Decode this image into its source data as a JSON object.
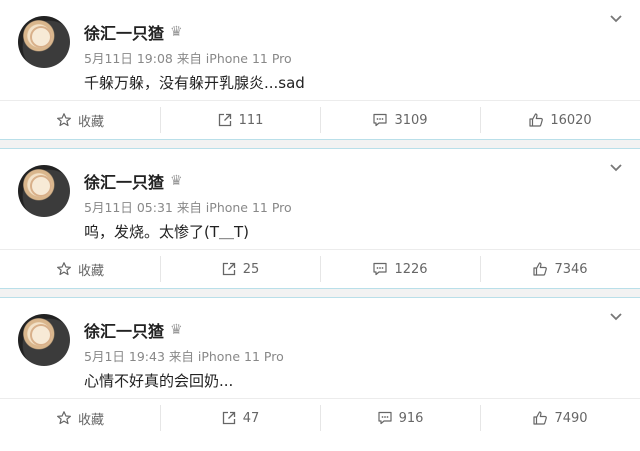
{
  "posts": [
    {
      "username": "徐汇一只猹",
      "meta": "5月11日 19:08 来自 iPhone 11 Pro",
      "content": "千躲万躲，没有躲开乳腺炎...sad",
      "actions": {
        "favorite_label": "收藏",
        "repost_count": "111",
        "comment_count": "3109",
        "like_count": "16020"
      }
    },
    {
      "username": "徐汇一只猹",
      "meta": "5月11日 05:31 来自 iPhone 11 Pro",
      "content": "呜，发烧。太惨了(T＿T)",
      "actions": {
        "favorite_label": "收藏",
        "repost_count": "25",
        "comment_count": "1226",
        "like_count": "7346"
      }
    },
    {
      "username": "徐汇一只猹",
      "meta": "5月1日 19:43 来自 iPhone 11 Pro",
      "content": "心情不好真的会回奶...",
      "actions": {
        "favorite_label": "收藏",
        "repost_count": "47",
        "comment_count": "916",
        "like_count": "7490"
      }
    }
  ],
  "icons": {
    "badge": "crown-badge-icon",
    "menu": "chevron-down-icon",
    "favorite": "star-icon",
    "repost": "share-icon",
    "comment": "comment-icon",
    "like": "thumbs-up-icon"
  },
  "colors": {
    "separator": "#b9dfe9",
    "text": "#222222",
    "meta": "#888888"
  }
}
